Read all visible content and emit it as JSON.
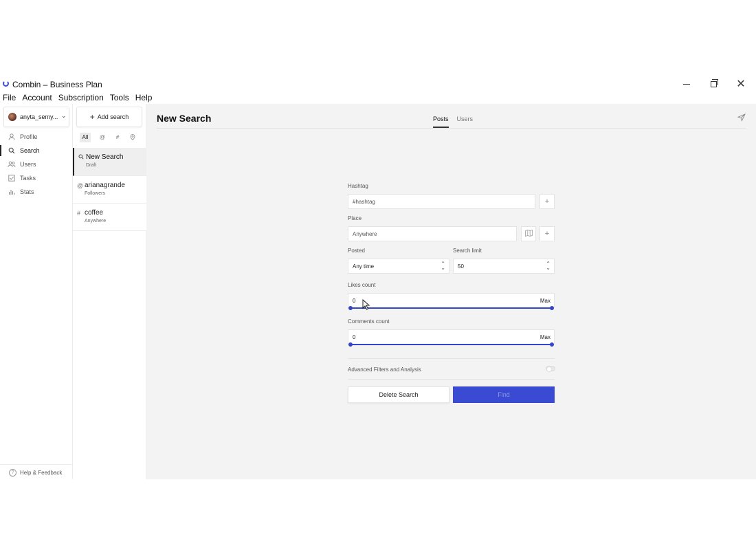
{
  "window": {
    "title": "Combin – Business Plan"
  },
  "menu": {
    "items": [
      "File",
      "Account",
      "Subscription",
      "Tools",
      "Help"
    ]
  },
  "sidebar": {
    "account_name": "anyta_semy...",
    "items": [
      {
        "label": "Profile",
        "icon": "user-icon"
      },
      {
        "label": "Search",
        "icon": "search-icon"
      },
      {
        "label": "Users",
        "icon": "users-icon"
      },
      {
        "label": "Tasks",
        "icon": "tasks-icon"
      },
      {
        "label": "Stats",
        "icon": "stats-icon"
      }
    ],
    "active": "Search",
    "help_label": "Help & Feedback"
  },
  "searches": {
    "add_label": "Add search",
    "filters": [
      "All",
      "@",
      "#",
      "location"
    ],
    "items": [
      {
        "title": "New Search",
        "subtitle": "Draft",
        "icon": "search-icon"
      },
      {
        "title": "arianagrande",
        "subtitle": "Followers",
        "icon": "@"
      },
      {
        "title": "coffee",
        "subtitle": "Anywhere",
        "icon": "#"
      }
    ]
  },
  "main": {
    "title": "New Search",
    "tabs": [
      "Posts",
      "Users"
    ],
    "active_tab": "Posts"
  },
  "form": {
    "hashtag_label": "Hashtag",
    "hashtag_placeholder": "#hashtag",
    "place_label": "Place",
    "place_placeholder": "Anywhere",
    "posted_label": "Posted",
    "posted_value": "Any time",
    "limit_label": "Search limit",
    "limit_value": "50",
    "likes_label": "Likes count",
    "likes_min": "0",
    "likes_max": "Max",
    "comments_label": "Comments count",
    "comments_min": "0",
    "comments_max": "Max",
    "advanced_label": "Advanced Filters and Analysis",
    "delete_label": "Delete Search",
    "find_label": "Find"
  },
  "colors": {
    "accent": "#3645c6",
    "find_button": "#3a4ad2"
  }
}
